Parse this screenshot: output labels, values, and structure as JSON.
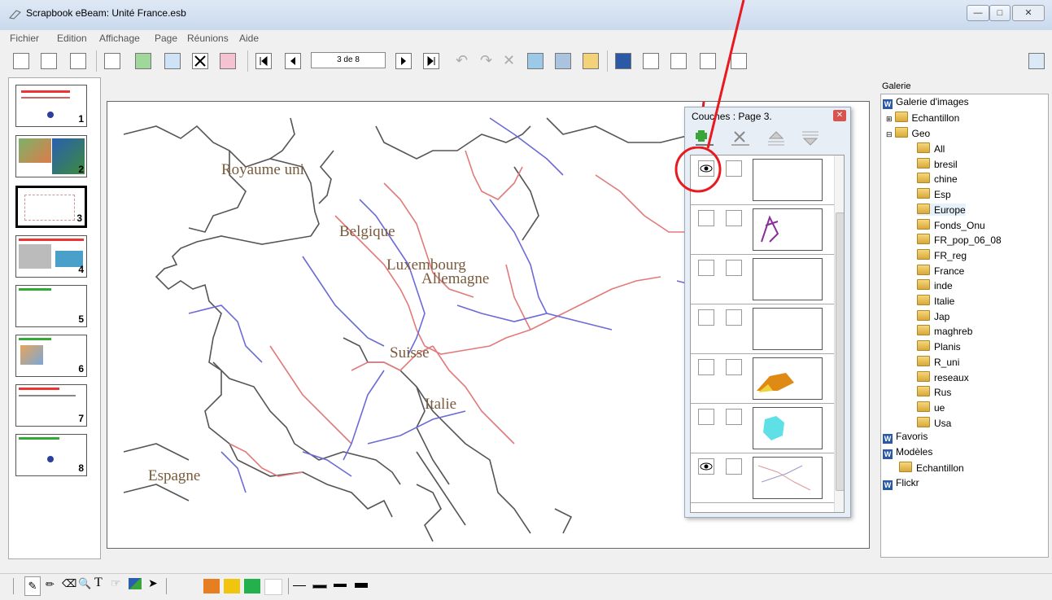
{
  "window": {
    "title": "Scrapbook eBeam: Unité France.esb"
  },
  "menu": [
    "Fichier",
    "Edition",
    "Affichage",
    "Page",
    "Réunions",
    "Aide"
  ],
  "toolbar": {
    "page_counter": "3 de 8"
  },
  "thumbnails": {
    "numbers": [
      "1",
      "2",
      "3",
      "4",
      "5",
      "6",
      "7",
      "8"
    ],
    "selected": "3"
  },
  "map": {
    "labels": [
      "Royaume uni",
      "Belgique",
      "Luxembourg",
      "Allemagne",
      "Suisse",
      "Italie",
      "Espagne"
    ]
  },
  "layers": {
    "title": "Couches : Page 3.",
    "visible_rows": [
      1,
      7
    ]
  },
  "gallery": {
    "header": "Galerie",
    "root": "Galerie d'images",
    "echantillon": "Echantillon",
    "geo": "Geo",
    "geo_items": [
      "All",
      "bresil",
      "chine",
      "Esp",
      "Europe",
      "Fonds_Onu",
      "FR_pop_06_08",
      "FR_reg",
      "France",
      "inde",
      "Italie",
      "Jap",
      "maghreb",
      "Planis",
      "R_uni",
      "reseaux",
      "Rus",
      "ue",
      "Usa"
    ],
    "selected": "Europe",
    "favoris": "Favoris",
    "modeles": "Modèles",
    "modeles_child": "Echantillon",
    "flickr": "Flickr"
  },
  "palette": {
    "colors": [
      "#e67e22",
      "#f1c40f",
      "#22b14c",
      "#ffffff"
    ]
  },
  "annotation": {
    "color": "#e8191f"
  }
}
